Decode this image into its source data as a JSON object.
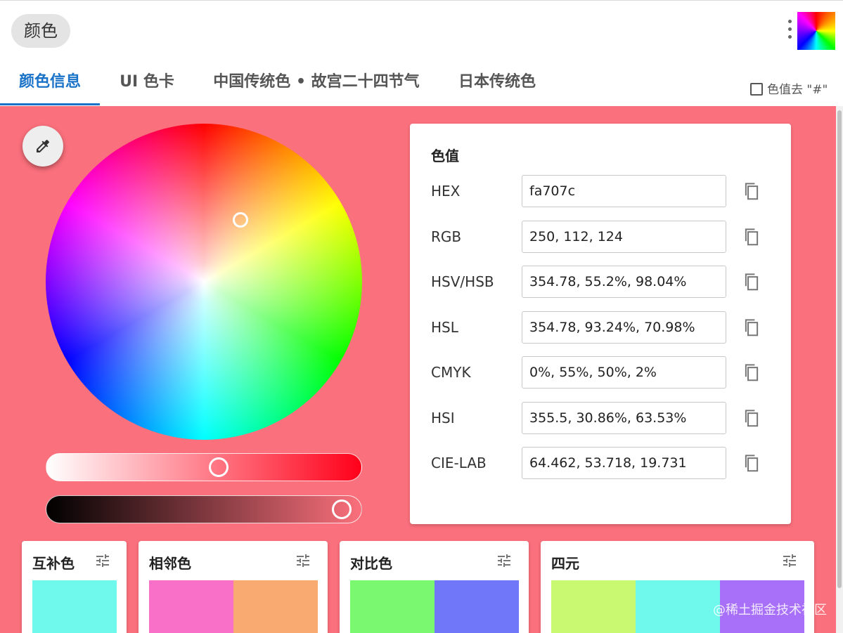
{
  "header": {
    "app_title": "颜色",
    "menu_icon": "more-vert-icon",
    "logo_icon": "color-wheel-logo"
  },
  "tabs": [
    {
      "label": "颜色信息",
      "active": true
    },
    {
      "label": "UI 色卡",
      "active": false
    },
    {
      "label": "中国传统色 • 故宫二十四节气",
      "active": false
    },
    {
      "label": "日本传统色",
      "active": false
    }
  ],
  "strip_hash": {
    "label": "色值去 \"#\"",
    "checked": false
  },
  "current_color": "#fa707c",
  "picker": {
    "eyedropper_icon": "eyedropper-icon",
    "saturation_percent": 55.2,
    "value_percent": 98.04
  },
  "values": {
    "title": "色值",
    "copy_icon": "copy-icon",
    "rows": [
      {
        "label": "HEX",
        "value": "fa707c"
      },
      {
        "label": "RGB",
        "value": "250, 112, 124"
      },
      {
        "label": "HSV/HSB",
        "value": "354.78, 55.2%, 98.04%"
      },
      {
        "label": "HSL",
        "value": "354.78, 93.24%, 70.98%"
      },
      {
        "label": "CMYK",
        "value": "0%, 55%, 50%, 2%"
      },
      {
        "label": "HSI",
        "value": "355.5, 30.86%, 63.53%"
      },
      {
        "label": "CIE-LAB",
        "value": "64.462, 53.718, 19.731"
      }
    ]
  },
  "schemes": [
    {
      "title": "互补色",
      "colors": [
        "#6ff9ed"
      ]
    },
    {
      "title": "相邻色",
      "colors": [
        "#f970c8",
        "#f9aa70"
      ]
    },
    {
      "title": "对比色",
      "colors": [
        "#7af970",
        "#7078f9"
      ]
    },
    {
      "title": "四元",
      "colors": [
        "#c8f970",
        "#6ff9ed",
        "#a870f9"
      ]
    }
  ],
  "scheme_tune_icon": "tune-icon",
  "watermark": "@稀土掘金技术社区"
}
